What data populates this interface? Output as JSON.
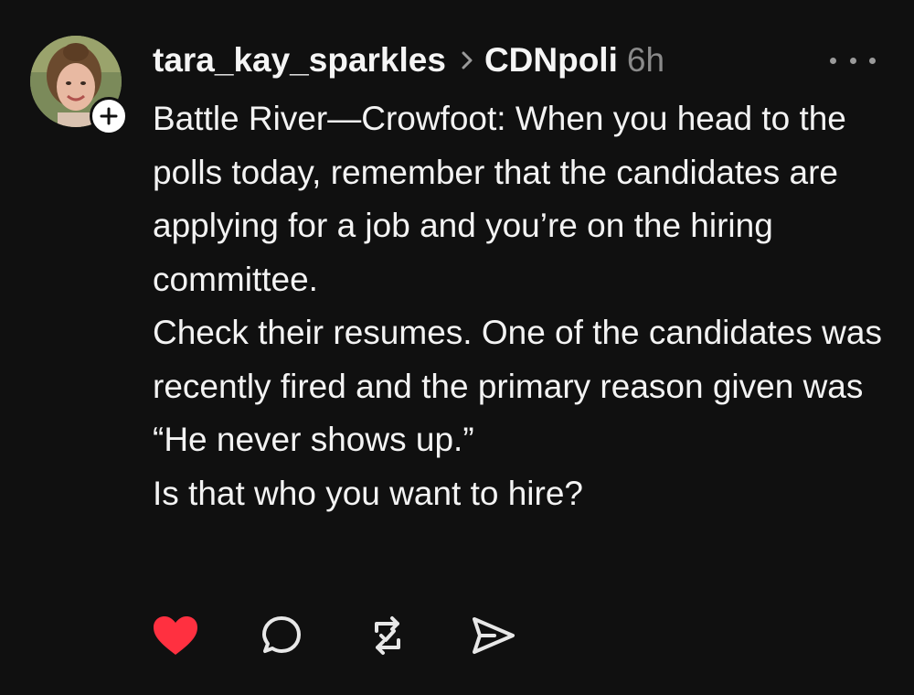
{
  "post": {
    "username": "tara_kay_sparkles",
    "community": "CDNpoli",
    "time_ago": "6h",
    "body": [
      "Battle River—Crowfoot: When you head to the polls today, remember that the candidates are applying for a job and you’re on the hiring committee.",
      "Check their resumes. One of the candidates was recently fired and the primary reason given was “He never shows up.”",
      "Is that who you want to hire?"
    ]
  },
  "icons": {
    "follow": "plus-icon",
    "separator": "chevron-right-icon",
    "more": "more-horizontal-icon",
    "like": "heart-icon",
    "reply": "comment-bubble-icon",
    "repost": "repost-icon",
    "share": "send-icon"
  },
  "colors": {
    "background": "#101010",
    "text": "#f3f3f3",
    "muted": "#8a8a8a",
    "like_active": "#ff3040"
  },
  "state": {
    "liked": true
  }
}
